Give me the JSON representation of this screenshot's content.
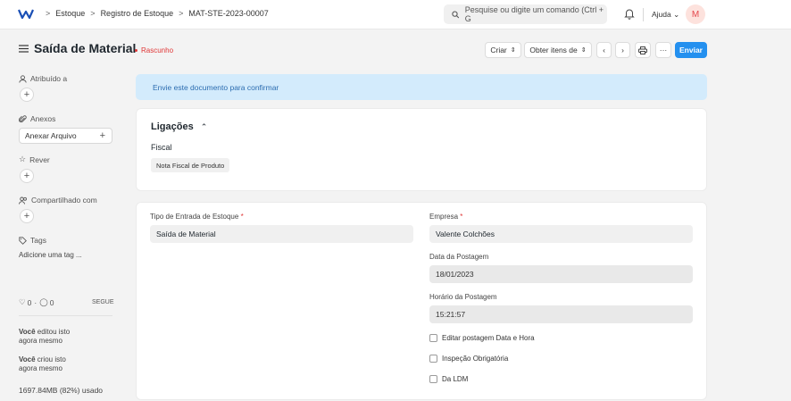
{
  "navbar": {
    "breadcrumbs": [
      "Estoque",
      "Registro de Estoque",
      "MAT-STE-2023-00007"
    ],
    "search_placeholder": "Pesquise ou digite um comando (Ctrl + G",
    "help_label": "Ajuda",
    "avatar_initial": "M"
  },
  "page": {
    "title": "Saída de Material",
    "status": "Rascunho"
  },
  "toolbar": {
    "create_label": "Criar",
    "get_items_label": "Obter itens de",
    "more_label": "···",
    "submit_label": "Enviar"
  },
  "sidebar": {
    "assigned_label": "Atribuído a",
    "attachments_label": "Anexos",
    "attach_button": "Anexar Arquivo",
    "review_label": "Rever",
    "shared_label": "Compartilhado com",
    "tags_label": "Tags",
    "add_tag": "Adicione uma tag ...",
    "likes": "0",
    "comments": "0",
    "follow_label": "SEGUE",
    "activity": [
      {
        "user": "Você",
        "action": " editou isto",
        "time": "agora mesmo"
      },
      {
        "user": "Você",
        "action": " criou isto",
        "time": "agora mesmo"
      }
    ],
    "memory": "1697.84MB (82%) usado"
  },
  "banner": {
    "text": "Envie este documento para confirmar"
  },
  "connections": {
    "title": "Ligações",
    "group": "Fiscal",
    "item": "Nota Fiscal de Produto"
  },
  "form": {
    "entry_type_label": "Tipo de Entrada de Estoque",
    "entry_type_value": "Saída de Material",
    "company_label": "Empresa",
    "company_value": "Valente Colchões",
    "posting_date_label": "Data da Postagem",
    "posting_date_value": "18/01/2023",
    "posting_time_label": "Horário da Postagem",
    "posting_time_value": "15:21:57",
    "checkbox_edit_posting": "Editar postagem Data e Hora",
    "checkbox_inspection": "Inspeção Obrigatória",
    "checkbox_bom": "Da LDM"
  },
  "colors": {
    "primary": "#2490ef",
    "draft": "#e03636",
    "banner_bg": "#d3ebfc"
  }
}
